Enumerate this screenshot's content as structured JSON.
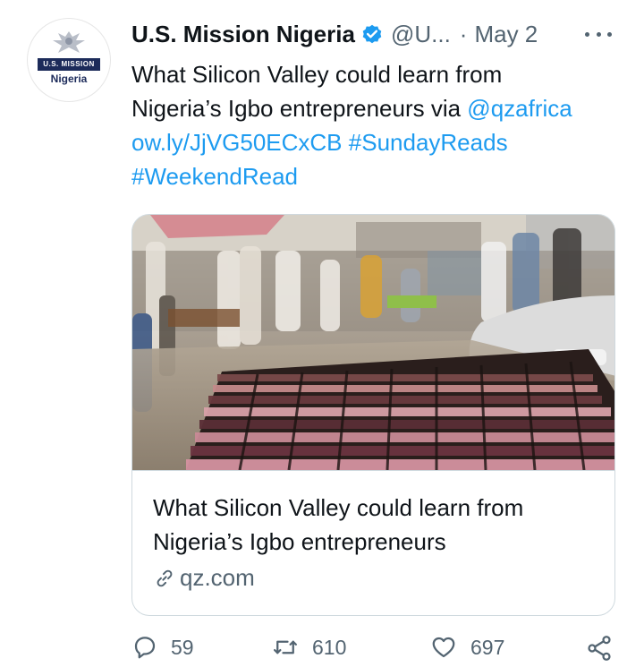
{
  "avatar": {
    "band_text": "U.S. MISSION",
    "country_text": "Nigeria"
  },
  "header": {
    "display_name": "U.S. Mission Nigeria",
    "handle": "@U...",
    "separator": "·",
    "date": "May 2"
  },
  "tweet": {
    "text_line1": "What Silicon Valley could learn from",
    "text_line2_prefix": "Nigeria’s Igbo entrepreneurs via ",
    "mention": "@qzafrica",
    "short_link": "ow.ly/JjVG50ECxCB",
    "hashtag1": "#SundayReads",
    "hashtag2": "#WeekendRead"
  },
  "card": {
    "title_line1": "What Silicon Valley could learn from",
    "title_line2": "Nigeria’s Igbo entrepreneurs",
    "domain": "qz.com"
  },
  "actions": {
    "replies": "59",
    "retweets": "610",
    "likes": "697"
  },
  "colors": {
    "link": "#1d9bf0",
    "text": "#0f1419",
    "muted": "#536471",
    "border": "#cfd9de"
  }
}
